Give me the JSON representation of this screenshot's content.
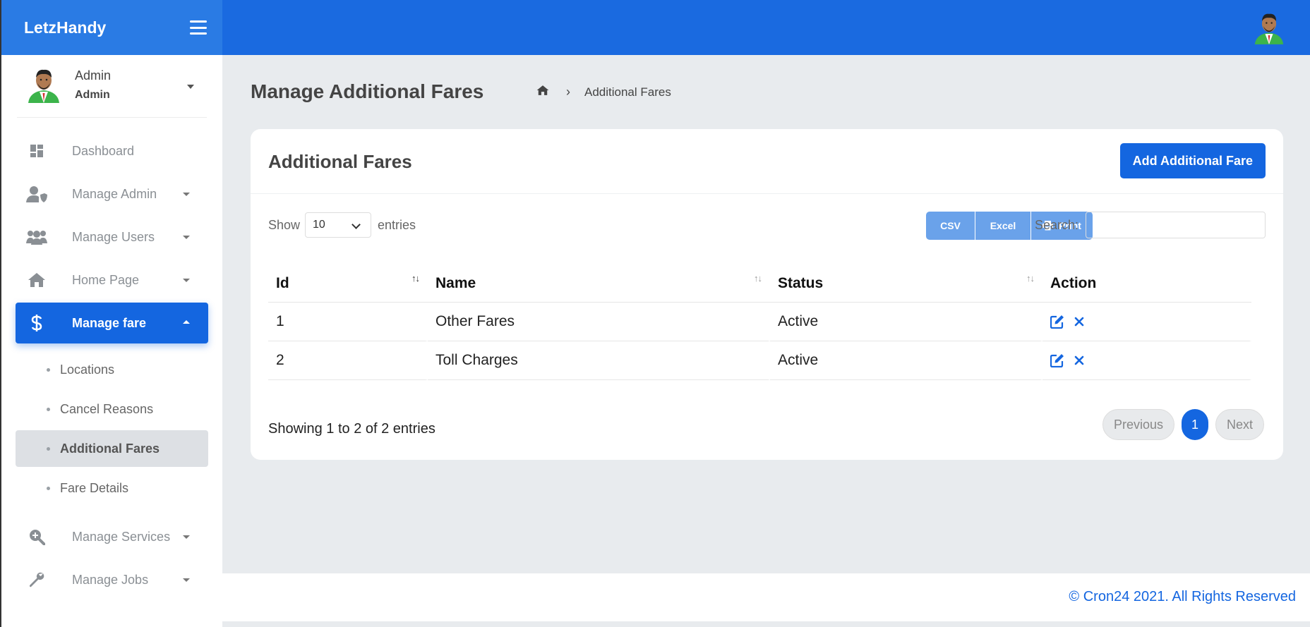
{
  "brand": {
    "name": "LetzHandy"
  },
  "user": {
    "name": "Admin",
    "role": "Admin"
  },
  "sidebar": {
    "items": [
      {
        "label": "Dashboard",
        "icon": "dashboard-icon"
      },
      {
        "label": "Manage Admin",
        "icon": "user-shield-icon"
      },
      {
        "label": "Manage Users",
        "icon": "users-icon"
      },
      {
        "label": "Home Page",
        "icon": "home-icon"
      },
      {
        "label": "Manage fare",
        "icon": "dollar-icon"
      },
      {
        "label": "Manage Services",
        "icon": "search-plus-icon"
      },
      {
        "label": "Manage Jobs",
        "icon": "wrench-icon"
      }
    ],
    "subitems": [
      {
        "label": "Locations"
      },
      {
        "label": "Cancel Reasons"
      },
      {
        "label": "Additional Fares"
      },
      {
        "label": "Fare Details"
      }
    ]
  },
  "page": {
    "title": "Manage Additional Fares",
    "breadcrumb": "Additional Fares"
  },
  "card": {
    "title": "Additional Fares",
    "add_button": "Add Additional Fare"
  },
  "toolbar": {
    "show_label": "Show",
    "entries_value": "10",
    "entries_label": "entries",
    "csv": "CSV",
    "excel": "Excel",
    "print": "Print",
    "search_label": "Search:"
  },
  "table": {
    "headers": [
      "Id",
      "Name",
      "Status",
      "Action"
    ],
    "rows": [
      {
        "id": "1",
        "name": "Other Fares",
        "status": "Active"
      },
      {
        "id": "2",
        "name": "Toll Charges",
        "status": "Active"
      }
    ]
  },
  "pagination": {
    "info": "Showing 1 to 2 of 2 entries",
    "previous": "Previous",
    "page": "1",
    "next": "Next"
  },
  "footer": {
    "text": "© Cron24 2021. All Rights Reserved"
  },
  "colors": {
    "primary": "#1466e0",
    "topbar": "#1a6ae0",
    "export": "#6aa2ea"
  }
}
